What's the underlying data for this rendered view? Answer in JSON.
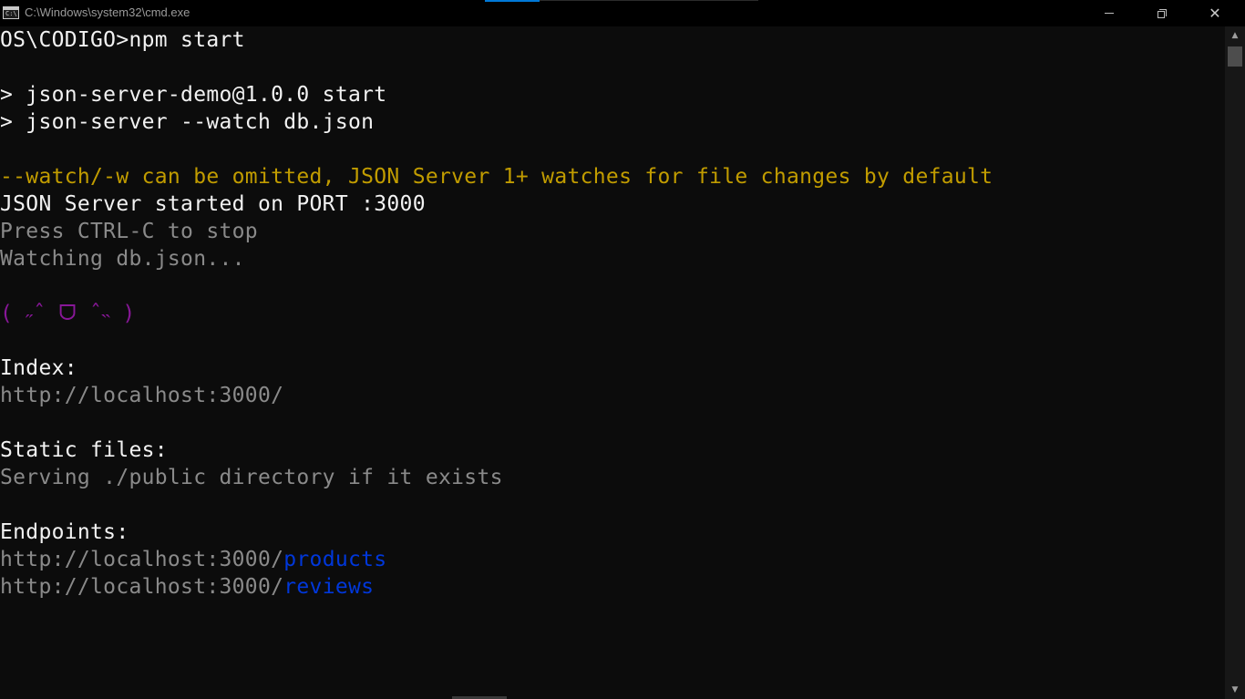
{
  "window": {
    "title": "C:\\Windows\\system32\\cmd.exe",
    "app_icon_label": "C:\\"
  },
  "controls": {
    "minimize_icon": "minimize-icon",
    "maximize_icon": "restore-icon",
    "close_symbol": "✕"
  },
  "console": {
    "lines": [
      {
        "segments": [
          {
            "text": "OS\\CODIGO>npm start",
            "color": "white"
          }
        ]
      },
      {
        "segments": []
      },
      {
        "segments": [
          {
            "text": "> json-server-demo@1.0.0 start",
            "color": "white"
          }
        ]
      },
      {
        "segments": [
          {
            "text": "> json-server --watch db.json",
            "color": "white"
          }
        ]
      },
      {
        "segments": []
      },
      {
        "segments": [
          {
            "text": "--watch/-w can be omitted, JSON Server 1+ watches for file changes by default",
            "color": "yellow"
          }
        ]
      },
      {
        "segments": [
          {
            "text": "JSON Server started on PORT :3000",
            "color": "white"
          }
        ]
      },
      {
        "segments": [
          {
            "text": "Press CTRL-C to stop",
            "color": "gray"
          }
        ]
      },
      {
        "segments": [
          {
            "text": "Watching db.json...",
            "color": "gray"
          }
        ]
      },
      {
        "segments": []
      },
      {
        "segments": [
          {
            "text": "( ˶ˆ ᗜ ˆ˵ )",
            "color": "purple"
          }
        ]
      },
      {
        "segments": []
      },
      {
        "segments": [
          {
            "text": "Index:",
            "color": "white"
          }
        ]
      },
      {
        "segments": [
          {
            "text": "http://localhost:3000/",
            "color": "gray"
          }
        ]
      },
      {
        "segments": []
      },
      {
        "segments": [
          {
            "text": "Static files:",
            "color": "white"
          }
        ]
      },
      {
        "segments": [
          {
            "text": "Serving ./public directory if it exists",
            "color": "gray"
          }
        ]
      },
      {
        "segments": []
      },
      {
        "segments": [
          {
            "text": "Endpoints:",
            "color": "white"
          }
        ]
      },
      {
        "segments": [
          {
            "text": "http://localhost:3000/",
            "color": "gray"
          },
          {
            "text": "products",
            "color": "blue"
          }
        ]
      },
      {
        "segments": [
          {
            "text": "http://localhost:3000/",
            "color": "gray"
          },
          {
            "text": "reviews",
            "color": "blue"
          }
        ]
      }
    ]
  },
  "colors": {
    "background": "#0c0c0c",
    "white": "#f2f2f2",
    "gray": "#8a8a8a",
    "yellow": "#c19c00",
    "purple": "#881798",
    "blue": "#0037da",
    "accent": "#0078d7"
  },
  "scrollbar": {
    "up_arrow": "▲",
    "down_arrow": "▼"
  }
}
